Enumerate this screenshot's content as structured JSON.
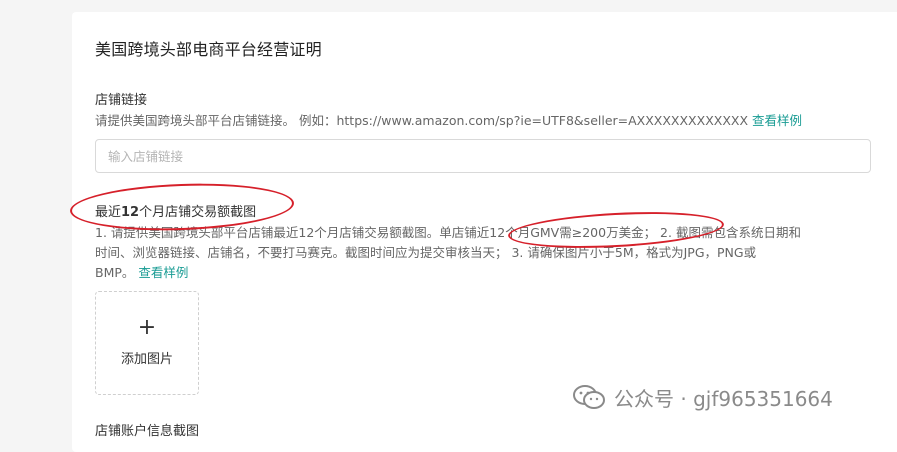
{
  "section": {
    "title": "美国跨境头部电商平台经营证明"
  },
  "store_link": {
    "label": "店铺链接",
    "help_text": "请提供美国跨境头部平台店铺链接。 例如：https://www.amazon.com/sp?ie=UTF8&seller=AXXXXXXXXXXXXX",
    "example_link": "查看样例",
    "input_placeholder": "输入店铺链接",
    "input_value": ""
  },
  "sales_screenshot": {
    "label_prefix": "最近",
    "label_num": "12",
    "label_suffix": "个月店铺交易额截图",
    "help_line1": "1. 请提供美国跨境头部平台店铺最近12个月店铺交易额截图。单店铺近12个月GMV需≥200万美金；  2. 截图需包含系统日期和",
    "help_line2": "时间、浏览器链接、店铺名，不要打马赛克。截图时间应为提交审核当天；  3. 请确保图片小于5M，格式为JPG，PNG或",
    "help_line3": "BMP。",
    "example_link": "查看样例",
    "upload_plus": "+",
    "upload_label": "添加图片"
  },
  "next_section": {
    "label": "店铺账户信息截图"
  },
  "watermark": {
    "text": "公众号 · gjf965351664",
    "icon": "wechat-icon"
  },
  "colors": {
    "link": "#1a9c94",
    "annotation": "#d6202a",
    "background": "#f5f5f5"
  }
}
